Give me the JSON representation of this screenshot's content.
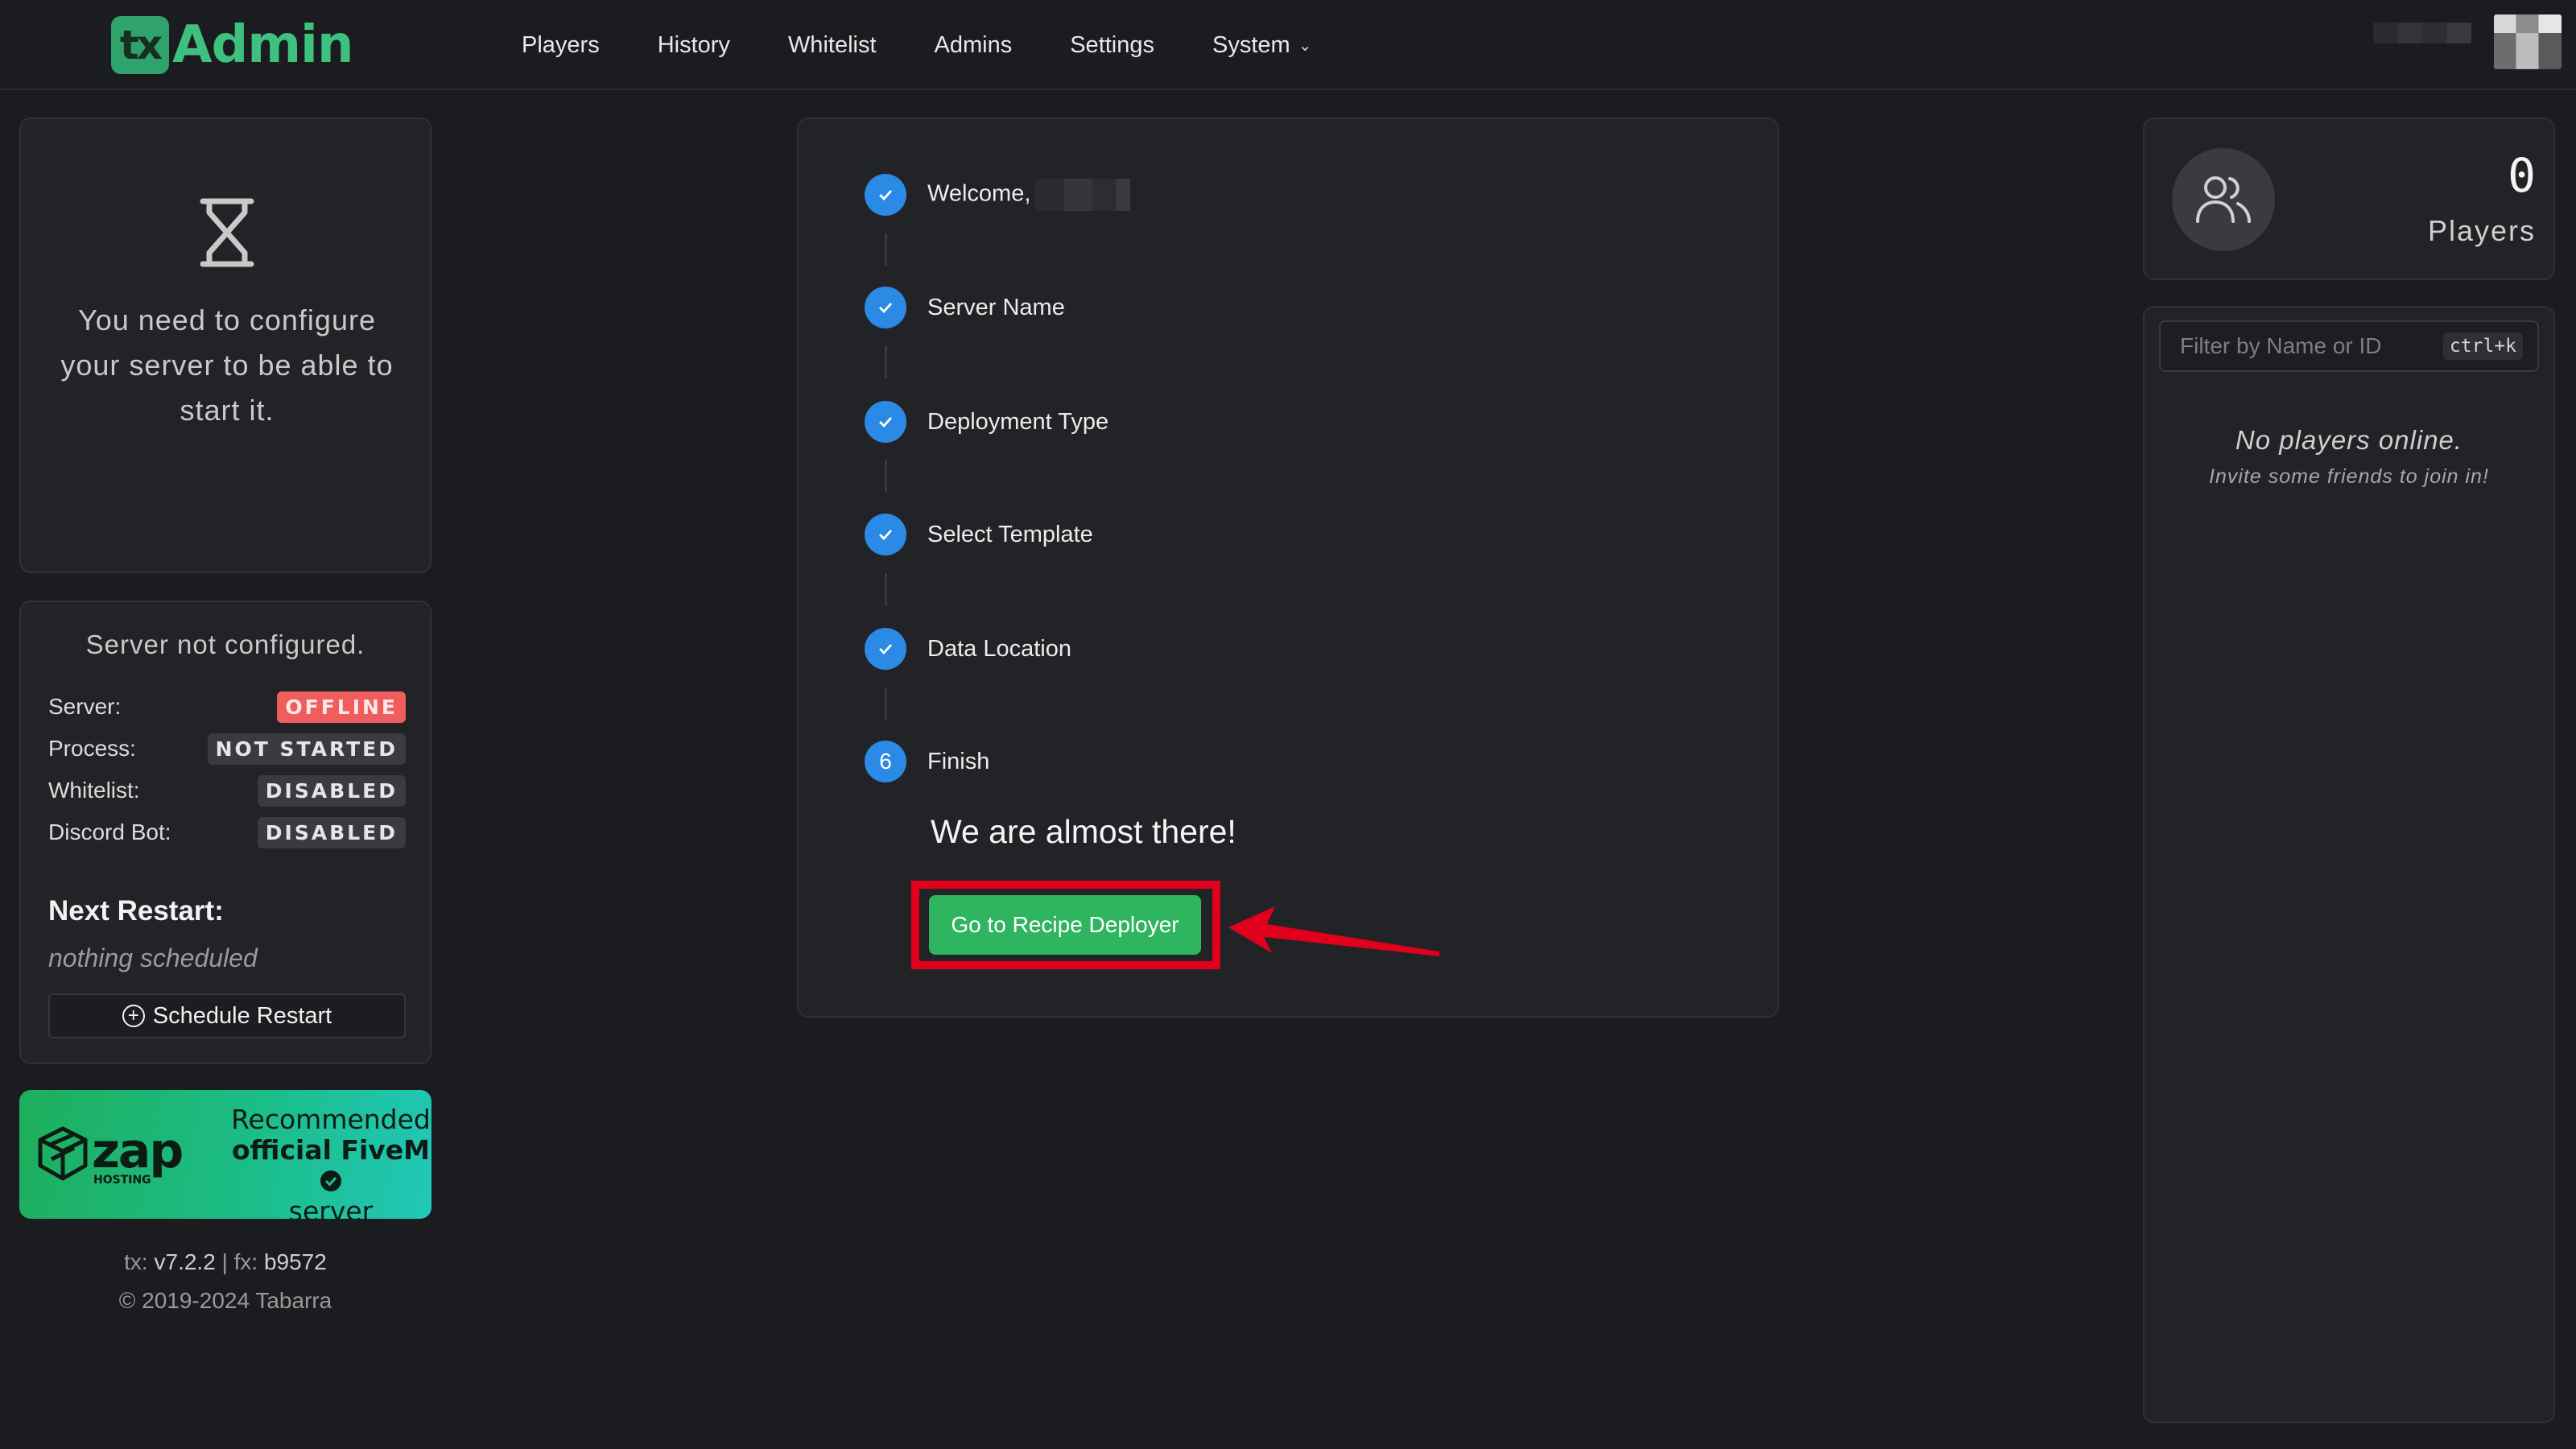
{
  "brand": {
    "tx": "tx",
    "name": "Admin"
  },
  "nav": {
    "players": "Players",
    "history": "History",
    "whitelist": "Whitelist",
    "admins": "Admins",
    "settings": "Settings",
    "system": "System"
  },
  "left": {
    "config_message": "You need to configure your server to be able to start it.",
    "server_title": "Server not configured.",
    "status": {
      "server_label": "Server:",
      "server_value": "OFFLINE",
      "process_label": "Process:",
      "process_value": "NOT STARTED",
      "whitelist_label": "Whitelist:",
      "whitelist_value": "DISABLED",
      "discord_label": "Discord Bot:",
      "discord_value": "DISABLED"
    },
    "next_restart_title": "Next Restart:",
    "next_restart_value": "nothing scheduled",
    "schedule_button": "Schedule Restart",
    "ad": {
      "logo_text": "zap",
      "logo_sub": "HOSTING",
      "line1": "Recommended",
      "line2": "official FiveM",
      "line3": "server provider"
    },
    "version_tx_label": "tx:",
    "version_tx": "v7.2.2",
    "version_sep": "|",
    "version_fx_label": "fx:",
    "version_fx": "b9572",
    "copyright": "© 2019-2024 Tabarra"
  },
  "setup": {
    "steps": [
      {
        "label": "Welcome,",
        "state": "done"
      },
      {
        "label": "Server Name",
        "state": "done"
      },
      {
        "label": "Deployment Type",
        "state": "done"
      },
      {
        "label": "Select Template",
        "state": "done"
      },
      {
        "label": "Data Location",
        "state": "done"
      },
      {
        "label": "Finish",
        "state": "active",
        "number": "6"
      }
    ],
    "almost_text": "We are almost there!",
    "deploy_button": "Go to Recipe Deployer"
  },
  "right": {
    "players_count": "0",
    "players_label": "Players",
    "filter_placeholder": "Filter by Name or ID",
    "filter_shortcut": "ctrl+k",
    "no_players": "No players online.",
    "invite": "Invite some friends to join in!"
  },
  "colors": {
    "accent_blue": "#2b8ae6",
    "accent_green": "#2fb560",
    "offline_red": "#f05d5d",
    "annotation_red": "#e0001b"
  },
  "icons": [
    "hourglass-icon",
    "check-icon",
    "plus-circle-icon",
    "users-icon",
    "chevron-down-icon",
    "zap-hosting-logo",
    "verified-badge-icon",
    "annotation-arrow"
  ]
}
